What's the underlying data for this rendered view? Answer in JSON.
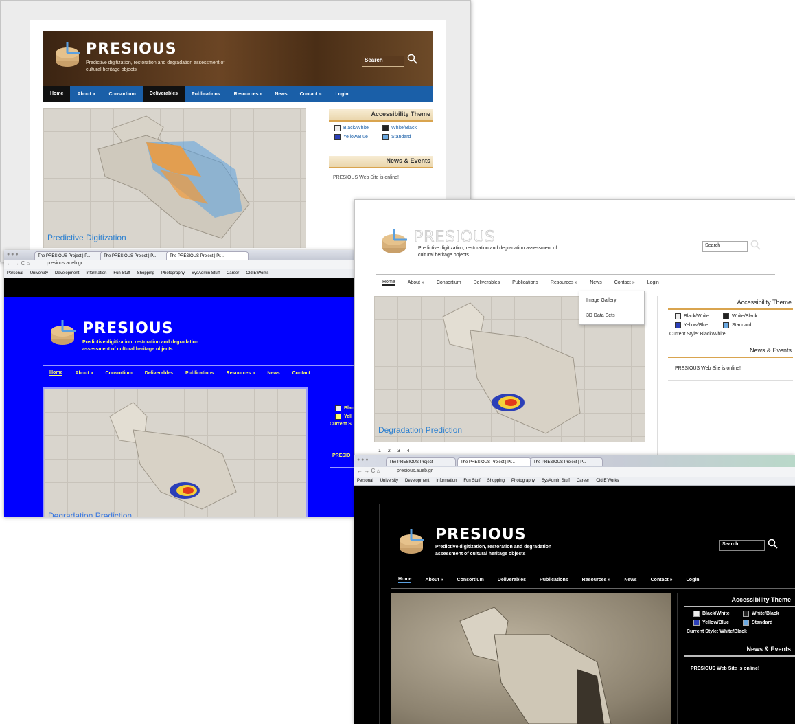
{
  "site": {
    "brand": "PRESIOUS",
    "tagline_lines": [
      "Predictive digitization, restoration and degradation assessment of",
      "cultural heritage objects"
    ],
    "tagline_bw_lines": [
      "Predictive digitization, restoration and degradation assessment of",
      "cultural heritage objects"
    ],
    "tagline_alt_lines": [
      "Predictive digitization, restoration and degradation",
      "assessment of cultural heritage objects"
    ],
    "search_placeholder": "Search",
    "nav": [
      "Home",
      "About »",
      "Consortium",
      "Deliverables",
      "Publications",
      "Resources »",
      "News",
      "Contact »",
      "Login"
    ],
    "nav_short_blue": [
      "Home",
      "About »",
      "Consortium",
      "Deliverables",
      "Publications",
      "Resources »",
      "News",
      "Contact"
    ],
    "accessibility_heading": "Accessibility Theme",
    "theme_options": [
      "Black/White",
      "White/Black",
      "Yellow/Blue",
      "Standard"
    ],
    "theme_options_blue": [
      "Blac",
      "Yell"
    ],
    "current_style_bw": "Current Style: Black/White",
    "current_style_wb": "Current Style: White/Black",
    "current_style_blue": "Current S",
    "news_heading": "News & Events",
    "news_item": "PRESIOUS Web Site is online!",
    "news_item_blue": "PRESIO",
    "captions": {
      "standard": "Predictive Digitization",
      "bw": "Degradation Prediction",
      "blue": "Degradation Prediction"
    },
    "resources_menu": [
      "Image Gallery",
      "3D Data Sets"
    ],
    "pager": [
      "1",
      "2",
      "3",
      "4"
    ]
  },
  "browser": {
    "tabs_blue": [
      "The PRESIOUS Project | P...",
      "The PRESIOUS Project | P...",
      "The PRESIOUS Project | Pr..."
    ],
    "tabs_black": [
      "The PRESIOUS Project",
      "The PRESIOUS Project | Pr...",
      "The PRESIOUS Project | P..."
    ],
    "url": "presious.aueb.gr",
    "bookmarks_blue": [
      "Personal",
      "University",
      "Development",
      "Information",
      "Fun Stuff",
      "Shopping",
      "Photography",
      "SysAdmin Stuff",
      "Career",
      "Old E'Works"
    ],
    "bookmarks_black": [
      "Personal",
      "University",
      "Development",
      "Information",
      "Fun Stuff",
      "Shopping",
      "Photography",
      "SysAdmin Stuff",
      "Career",
      "Old E'Works"
    ]
  },
  "colors": {
    "nav_blue": "#1a5fa8",
    "banner_brown": "#5a3a1e",
    "blue_theme": "#0000ff",
    "caption_blue": "#2a7fd0",
    "accent_orange": "#d9a44f",
    "sidebox_bg": "#f2e6c8"
  }
}
